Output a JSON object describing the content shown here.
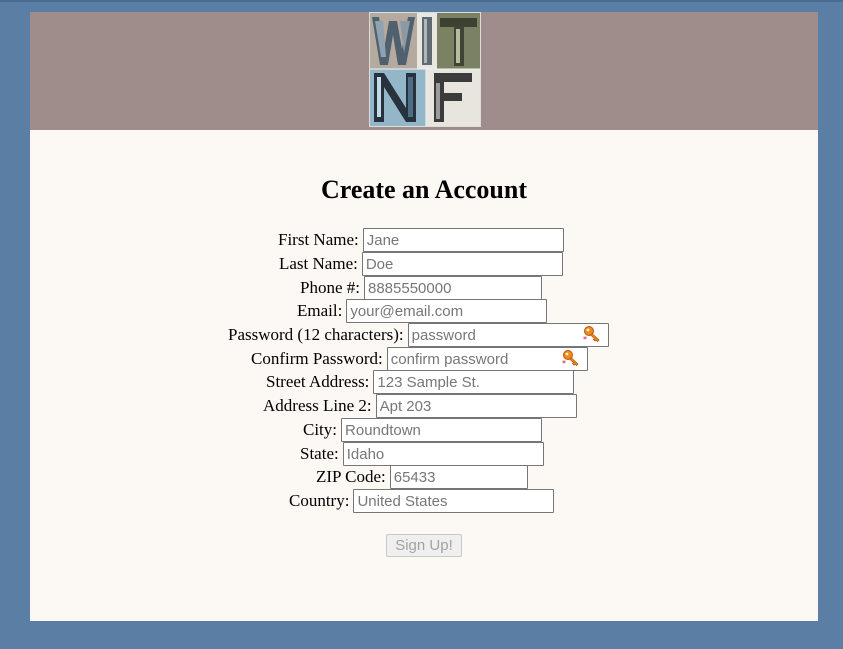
{
  "header": {
    "logo_name": "site-logo"
  },
  "form": {
    "title": "Create an Account",
    "fields": {
      "first_name": {
        "label": "First Name:",
        "placeholder": "Jane"
      },
      "last_name": {
        "label": "Last Name:",
        "placeholder": "Doe"
      },
      "phone": {
        "label": "Phone #:",
        "placeholder": "8885550000"
      },
      "email": {
        "label": "Email:",
        "placeholder": "your@email.com"
      },
      "password": {
        "label": "Password (12 characters):",
        "placeholder": "password",
        "icon": "password-key-icon"
      },
      "confirm_password": {
        "label": "Confirm Password:",
        "placeholder": "confirm password",
        "icon": "password-key-icon"
      },
      "street_address": {
        "label": "Street Address:",
        "placeholder": "123 Sample St."
      },
      "address_line_2": {
        "label": "Address Line 2:",
        "placeholder": "Apt 203"
      },
      "city": {
        "label": "City:",
        "placeholder": "Roundtown"
      },
      "state": {
        "label": "State:",
        "placeholder": "Idaho"
      },
      "zip": {
        "label": "ZIP Code:",
        "placeholder": "65433"
      },
      "country": {
        "label": "Country:",
        "placeholder": "United States"
      }
    },
    "submit_label": "Sign Up!",
    "submit_disabled": true
  },
  "colors": {
    "outer_background": "#5b7ea4",
    "header_background": "#9e8d8a",
    "page_background": "#fcf8f4",
    "key_icon": "#e8801c"
  }
}
